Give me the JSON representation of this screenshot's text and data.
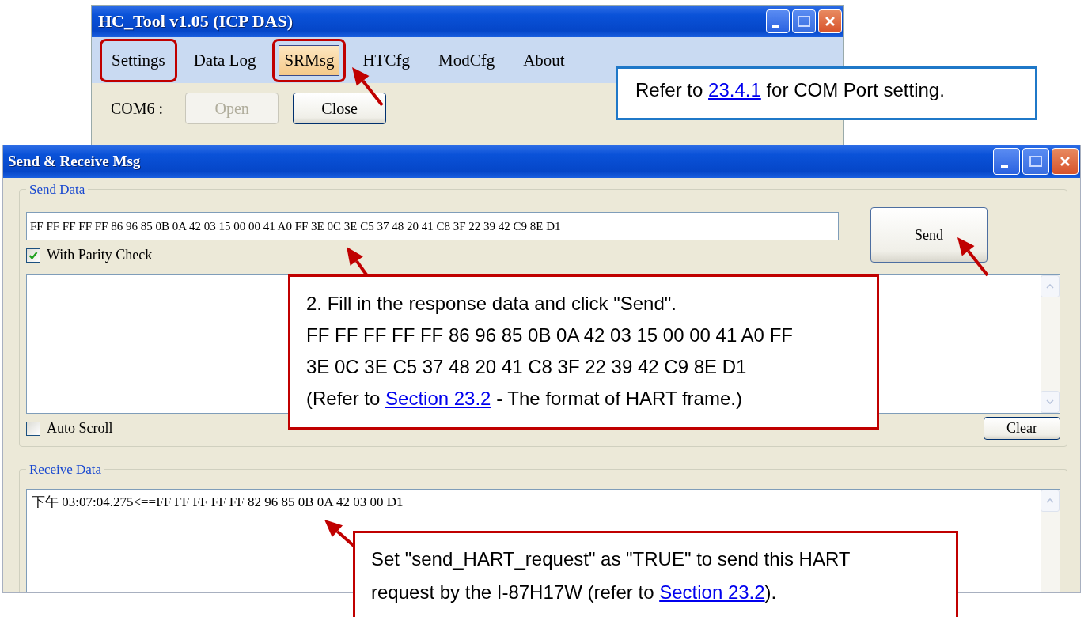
{
  "main_window": {
    "title": "HC_Tool v1.05  (ICP DAS)",
    "menu": [
      {
        "label": "Settings",
        "selected": false,
        "highlighted": true
      },
      {
        "label": "Data Log",
        "selected": false,
        "highlighted": false
      },
      {
        "label": "SRMsg",
        "selected": true,
        "highlighted": true
      },
      {
        "label": "HTCfg",
        "selected": false,
        "highlighted": false
      },
      {
        "label": "ModCfg",
        "selected": false,
        "highlighted": false
      },
      {
        "label": "About",
        "selected": false,
        "highlighted": false
      }
    ],
    "port_label": "COM6 :",
    "buttons": [
      {
        "label": "Open",
        "disabled": true
      },
      {
        "label": "Close",
        "disabled": false
      }
    ]
  },
  "dialog": {
    "title": "Send & Receive Msg",
    "send_group": {
      "title": "Send Data",
      "input_value": "FF FF FF FF FF 86 96 85 0B 0A 42 03 15 00 00 41 A0 FF 3E 0C 3E C5 37 48 20 41 C8 3F 22 39 42 C9 8E D1",
      "send_button": "Send",
      "parity_check": {
        "label": "With Parity Check",
        "checked": true
      },
      "auto_scroll": {
        "label": "Auto Scroll",
        "checked": false
      },
      "clear_button": "Clear"
    },
    "receive_group": {
      "title": "Receive Data",
      "lines": [
        "下午 03:07:04.275<==FF FF FF FF FF 82 96 85 0B 0A 42 03 00 D1"
      ]
    }
  },
  "annotations": [
    {
      "kind": "com",
      "color": "#1f78c8",
      "lines": [
        [
          {
            "text": "Refer to "
          },
          {
            "text": "23.4.1",
            "kind": "link"
          },
          {
            "text": " for COM Port setting."
          }
        ]
      ]
    },
    {
      "kind": "send",
      "color": "#c00000",
      "lines": [
        [
          {
            "text": "2. Fill in the response data and click \"Send\"."
          }
        ],
        [
          {
            "text": "FF FF FF FF FF 86 96 85 0B 0A 42 03 15 00 00 41 A0 FF"
          }
        ],
        [
          {
            "text": "3E 0C 3E C5 37 48 20 41 C8 3F 22 39 42 C9 8E D1"
          }
        ],
        [
          {
            "text": "(Refer to "
          },
          {
            "text": "Section 23.2",
            "kind": "link"
          },
          {
            "text": " - The format of HART frame.)"
          }
        ]
      ]
    },
    {
      "kind": "receive",
      "color": "#c00000",
      "lines": [
        [
          {
            "text": "Set \"send_HART_request\" as \"TRUE\" to send this HART"
          }
        ],
        [
          {
            "text": "request by the I-87H17W (refer to "
          },
          {
            "text": "Section 23.2",
            "kind": "link"
          },
          {
            "text": ")."
          }
        ]
      ]
    }
  ]
}
